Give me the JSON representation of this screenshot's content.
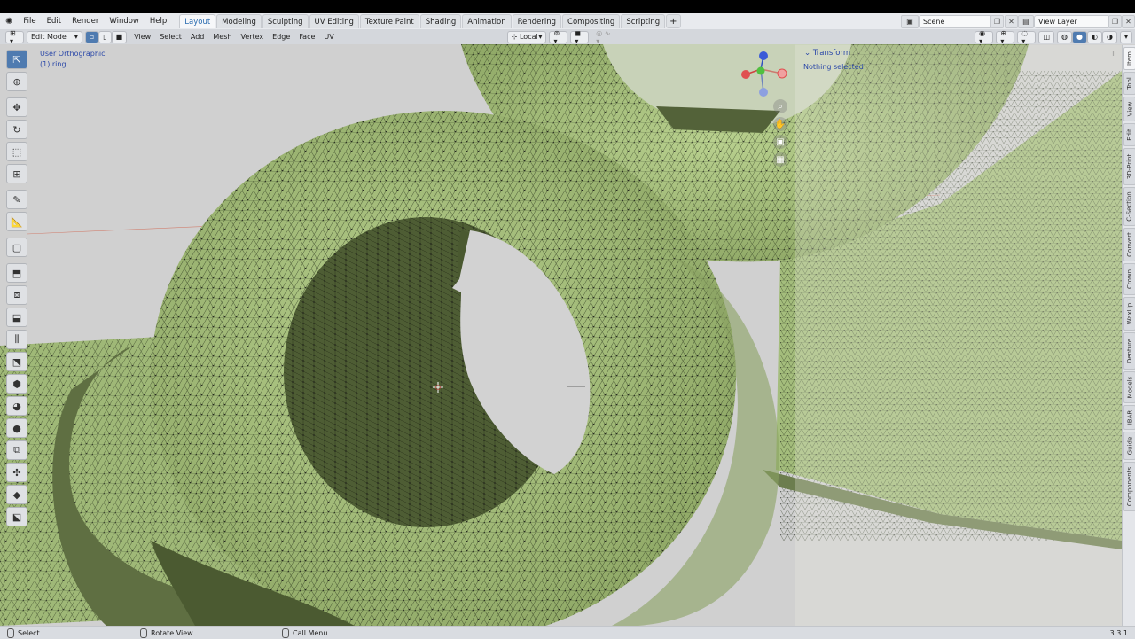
{
  "top_menu": {
    "items": [
      "File",
      "Edit",
      "Render",
      "Window",
      "Help"
    ]
  },
  "workspace_tabs": [
    {
      "label": "Layout",
      "active": true
    },
    {
      "label": "Modeling"
    },
    {
      "label": "Sculpting"
    },
    {
      "label": "UV Editing"
    },
    {
      "label": "Texture Paint"
    },
    {
      "label": "Shading"
    },
    {
      "label": "Animation"
    },
    {
      "label": "Rendering"
    },
    {
      "label": "Compositing"
    },
    {
      "label": "Scripting"
    }
  ],
  "workspace_add": "+",
  "scene": {
    "value": "Scene"
  },
  "view_layer": {
    "value": "View Layer"
  },
  "header": {
    "mode": "Edit Mode",
    "menus": [
      "View",
      "Select",
      "Add",
      "Mesh",
      "Vertex",
      "Edge",
      "Face",
      "UV"
    ],
    "orientation": "Local"
  },
  "viewport": {
    "view_name": "User Orthographic",
    "object_name": "(1) ring"
  },
  "npanel": {
    "section_title": "Transform",
    "status": "Nothing selected"
  },
  "sidebar_tabs": [
    "Item",
    "Tool",
    "View",
    "Edit",
    "3D-Print",
    "C-Section",
    "Convert",
    "Crown",
    "WaxUp",
    "Denture",
    "Models",
    "IBAR",
    "Guide",
    "Components"
  ],
  "gizmo_axes": {
    "z": "Z",
    "y": "Y",
    "x": "X"
  },
  "statusbar": {
    "select": "Select",
    "rotate": "Rotate View",
    "call_menu": "Call Menu",
    "version": "3.3.1"
  },
  "colors": {
    "mesh": "#a9c480",
    "mesh_shadow": "#5c6b40",
    "accent": "#2b48a8",
    "x_axis": "#e05050",
    "y_axis": "#5fc040",
    "z_axis": "#4060d0"
  }
}
